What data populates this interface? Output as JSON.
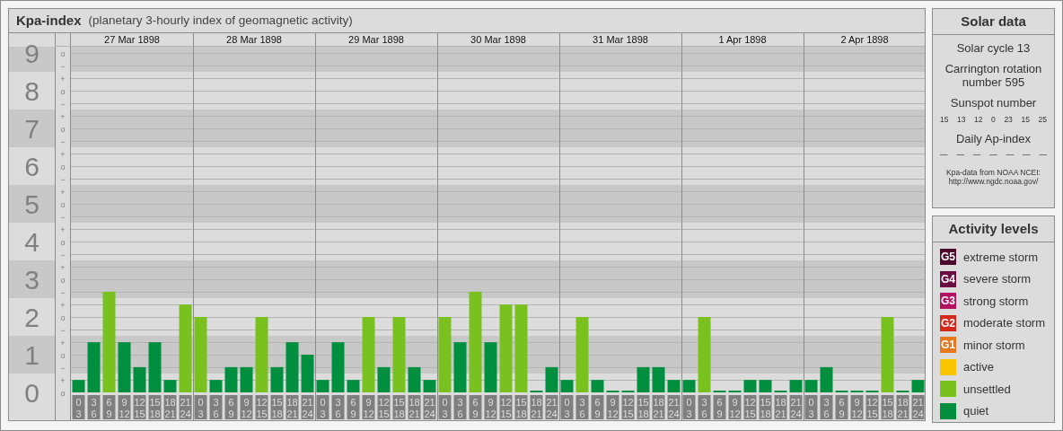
{
  "main_panel": {
    "title": "Kpa-index",
    "subtitle": "(planetary 3-hourly index of geomagnetic activity)",
    "chart_data": {
      "type": "bar",
      "stacked": true,
      "ylim": [
        0,
        9
      ],
      "yticks": [
        {
          "value": 0,
          "label": "0"
        },
        {
          "value": 1,
          "label": "1"
        },
        {
          "value": 2,
          "label": "2"
        },
        {
          "value": 3,
          "label": "3"
        },
        {
          "value": 4,
          "label": "4"
        },
        {
          "value": 5,
          "label": "5"
        },
        {
          "value": 6,
          "label": "6"
        },
        {
          "value": 7,
          "label": "7"
        },
        {
          "value": 8,
          "label": "8"
        },
        {
          "value": 9,
          "label": "9"
        }
      ],
      "grid": true,
      "bands": [
        {
          "axis": "y",
          "from": 0.5,
          "to": 1.5,
          "color": "#c8c8c8"
        },
        {
          "axis": "y",
          "from": 2.5,
          "to": 3.5,
          "color": "#c8c8c8"
        },
        {
          "axis": "y",
          "from": 4.5,
          "to": 5.5,
          "color": "#c8c8c8"
        },
        {
          "axis": "y",
          "from": 6.5,
          "to": 7.5,
          "color": "#c8c8c8"
        },
        {
          "axis": "y",
          "from": 8.5,
          "to": 9.5,
          "color": "#c8c8c8"
        }
      ],
      "categories": [
        "0\n3",
        "3\n6",
        "6\n9",
        "9\n12",
        "12\n15",
        "15\n18",
        "18\n21",
        "21\n24",
        "0\n3",
        "3\n6",
        "6\n9",
        "9\n12",
        "12\n15",
        "15\n18",
        "18\n21",
        "21\n24",
        "0\n3",
        "3\n6",
        "6\n9",
        "9\n12",
        "12\n15",
        "15\n18",
        "18\n21",
        "21\n24",
        "0\n3",
        "3\n6",
        "6\n9",
        "9\n12",
        "12\n15",
        "15\n18",
        "18\n21",
        "21\n24",
        "0\n3",
        "3\n6",
        "6\n9",
        "9\n12",
        "12\n15",
        "15\n18",
        "18\n21",
        "21\n24",
        "0\n3",
        "3\n6",
        "6\n9",
        "9\n12",
        "12\n15",
        "15\n18",
        "18\n21",
        "21\n24",
        "0\n3",
        "3\n6",
        "6\n9",
        "9\n12",
        "12\n15",
        "15\n18",
        "18\n21",
        "21\n24"
      ],
      "series": [
        {
          "color": "#008f3e",
          "values": [
            0.33,
            1.33,
            null,
            1.33,
            0.67,
            1.33,
            0.33,
            null,
            null,
            0.33,
            0.67,
            0.67,
            null,
            0.67,
            1.33,
            1,
            0.33,
            1.33,
            0.33,
            null,
            0.67,
            null,
            0.67,
            0.33,
            null,
            1.33,
            null,
            1.33,
            null,
            null,
            0,
            0.67,
            0.33,
            null,
            0.33,
            0,
            0,
            0.67,
            0.67,
            0.33,
            0.33,
            null,
            0,
            0,
            0.33,
            0.33,
            0,
            0.33,
            0.33,
            0.67,
            0,
            0,
            0,
            null,
            0,
            0.33
          ]
        },
        {
          "color": "#78c11f",
          "values": [
            null,
            null,
            2.67,
            null,
            null,
            null,
            null,
            2.33,
            2,
            null,
            null,
            null,
            2,
            null,
            null,
            null,
            null,
            null,
            null,
            2,
            null,
            2,
            null,
            null,
            2,
            null,
            2.67,
            null,
            2.33,
            2.33,
            null,
            null,
            null,
            2,
            null,
            null,
            null,
            null,
            null,
            null,
            null,
            2,
            null,
            null,
            null,
            null,
            null,
            null,
            null,
            null,
            null,
            null,
            null,
            2,
            null,
            null
          ]
        }
      ]
    },
    "kp_scale": [
      {
        "marks": [
          {
            "kind": "at",
            "label": "o"
          },
          {
            "kind": "below",
            "label": "−"
          }
        ]
      },
      {
        "marks": [
          {
            "kind": "above",
            "label": "+"
          },
          {
            "kind": "at",
            "label": "o"
          },
          {
            "kind": "below",
            "label": "−"
          }
        ]
      },
      {
        "marks": [
          {
            "kind": "above",
            "label": "+"
          },
          {
            "kind": "at",
            "label": "o"
          },
          {
            "kind": "below",
            "label": "−"
          }
        ]
      },
      {
        "marks": [
          {
            "kind": "above",
            "label": "+"
          },
          {
            "kind": "at",
            "label": "o"
          },
          {
            "kind": "below",
            "label": "−"
          }
        ]
      },
      {
        "marks": [
          {
            "kind": "above",
            "label": "+"
          },
          {
            "kind": "at",
            "label": "o"
          },
          {
            "kind": "below",
            "label": "−"
          }
        ]
      },
      {
        "marks": [
          {
            "kind": "above",
            "label": "+"
          },
          {
            "kind": "at",
            "label": "o"
          },
          {
            "kind": "below",
            "label": "−"
          }
        ]
      },
      {
        "marks": [
          {
            "kind": "above",
            "label": "+"
          },
          {
            "kind": "at",
            "label": "o"
          },
          {
            "kind": "below",
            "label": "−"
          }
        ]
      },
      {
        "marks": [
          {
            "kind": "above",
            "label": "+"
          },
          {
            "kind": "at",
            "label": "o"
          },
          {
            "kind": "below",
            "label": "−"
          }
        ]
      },
      {
        "marks": [
          {
            "kind": "above",
            "label": "+"
          },
          {
            "kind": "at",
            "label": "o"
          },
          {
            "kind": "below",
            "label": "−"
          }
        ]
      },
      {
        "marks": [
          {
            "kind": "above",
            "label": "+"
          },
          {
            "kind": "at",
            "label": "o"
          }
        ]
      }
    ],
    "days": [
      "27 Mar 1898",
      "28 Mar 1898",
      "29 Mar 1898",
      "30 Mar 1898",
      "31 Mar 1898",
      "1 Apr 1898",
      "2 Apr 1898"
    ]
  },
  "solar_data": {
    "title": "Solar data",
    "solar_cycle": "Solar cycle 13",
    "carrington": "Carrington rotation number 595",
    "sunspot_heading": "Sunspot number",
    "sunspot_numbers": [
      "15",
      "13",
      "12",
      "0",
      "23",
      "15",
      "25"
    ],
    "ap_heading": "Daily Ap-index",
    "ap_values": [
      "—",
      "—",
      "—",
      "—",
      "—",
      "—",
      "—"
    ],
    "source_lines": [
      "Kpa-data from NOAA NCEI:",
      "http://www.ngdc.noaa.gov/"
    ]
  },
  "activity_levels": {
    "title": "Activity levels",
    "items": [
      {
        "badge": "G5",
        "label": "extreme storm",
        "color": "#4d0a2c"
      },
      {
        "badge": "G4",
        "label": "severe storm",
        "color": "#6d0c40"
      },
      {
        "badge": "G3",
        "label": "strong storm",
        "color": "#b31060"
      },
      {
        "badge": "G2",
        "label": "moderate storm",
        "color": "#d5291c"
      },
      {
        "badge": "G1",
        "label": "minor storm",
        "color": "#e8781d"
      },
      {
        "label": "active",
        "color": "#f9c300"
      },
      {
        "label": "unsettled",
        "color": "#78c11f"
      },
      {
        "label": "quiet",
        "color": "#008f3e"
      }
    ]
  }
}
